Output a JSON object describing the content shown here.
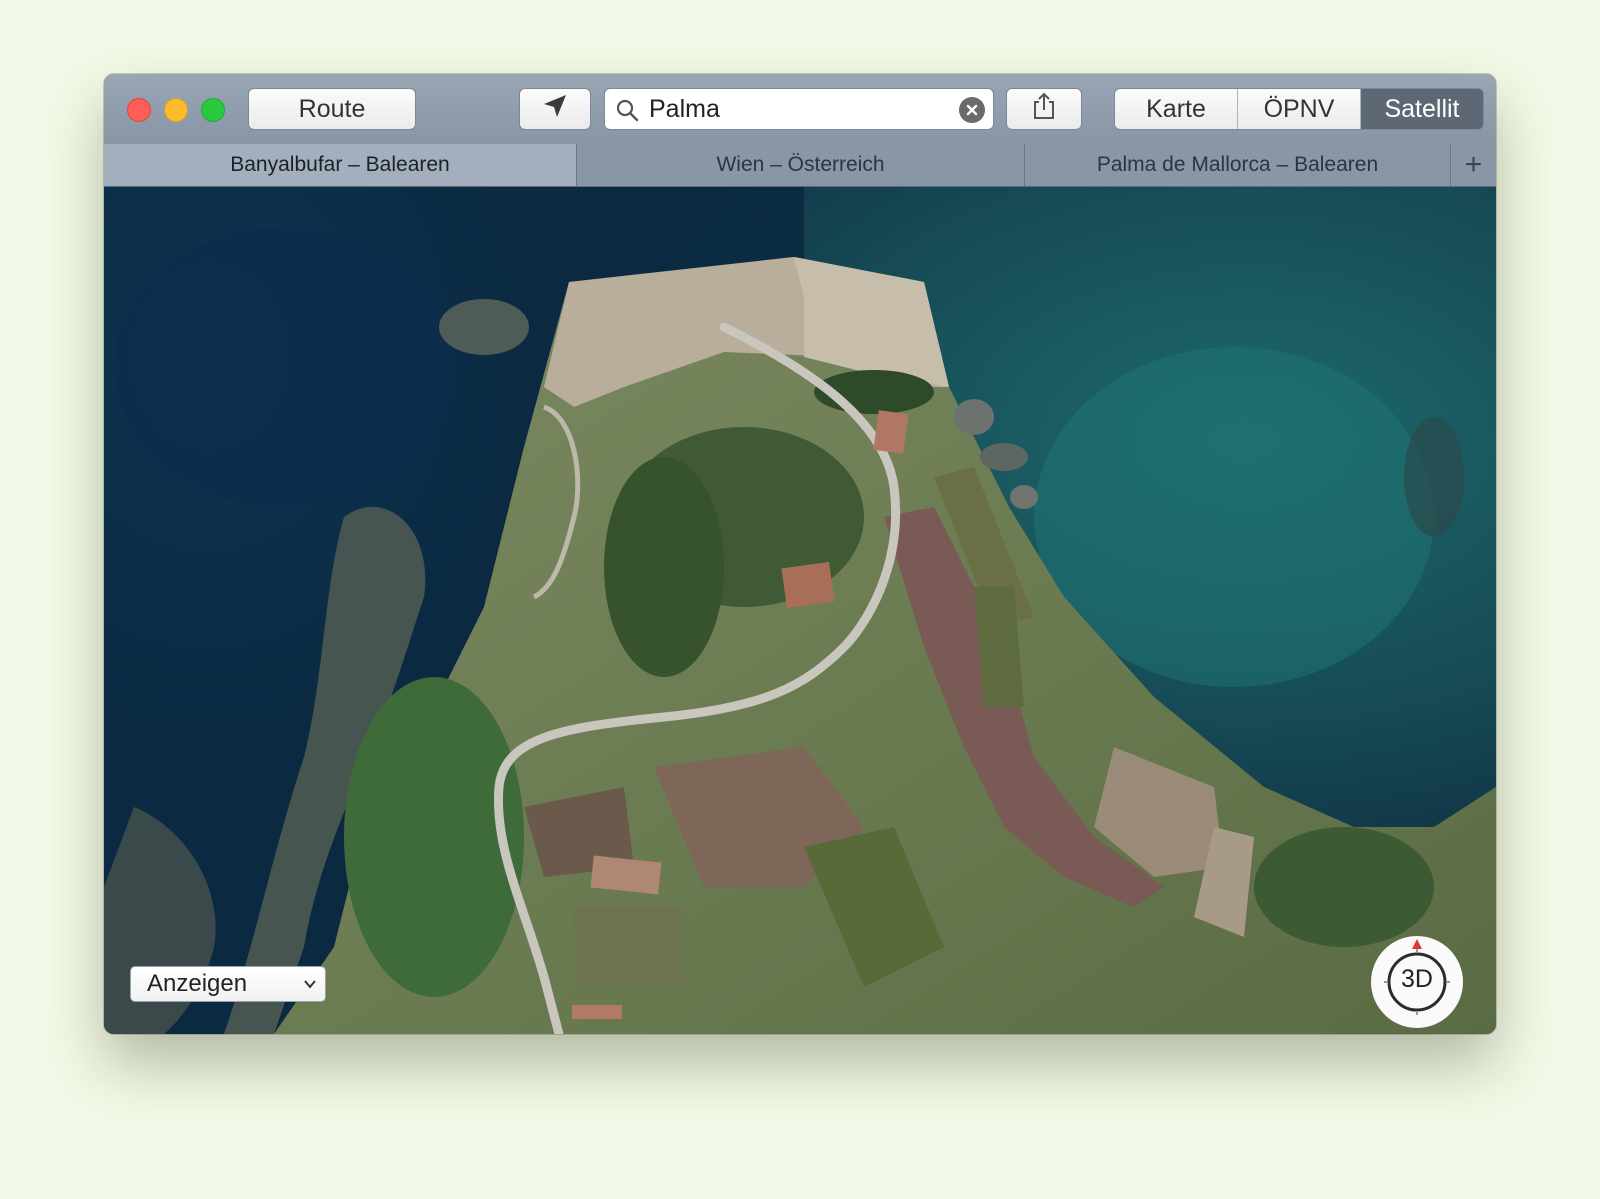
{
  "toolbar": {
    "route_label": "Route",
    "search_value": "Palma",
    "map_modes": [
      {
        "label": "Karte",
        "active": false
      },
      {
        "label": "ÖPNV",
        "active": false
      },
      {
        "label": "Satellit",
        "active": true
      }
    ]
  },
  "tabs": [
    {
      "label": "Banyalbufar – Balearen",
      "active": true
    },
    {
      "label": "Wien – Österreich",
      "active": false
    },
    {
      "label": "Palma de Mallorca – Balearen",
      "active": false
    }
  ],
  "tab_add_label": "+",
  "map": {
    "show_dropdown_label": "Anzeigen",
    "compass_label": "3D",
    "zoom_out_label": "−",
    "zoom_in_label": "+"
  },
  "colors": {
    "active_segment": "#5e6875",
    "close": "#fd5e55",
    "minimize": "#fdbc2e",
    "maximize": "#29c940",
    "compass_north": "#e0392f"
  },
  "icons": [
    "location-arrow-icon",
    "search-icon",
    "clear-icon",
    "share-icon",
    "chevron-down-icon",
    "compass-north-icon"
  ]
}
